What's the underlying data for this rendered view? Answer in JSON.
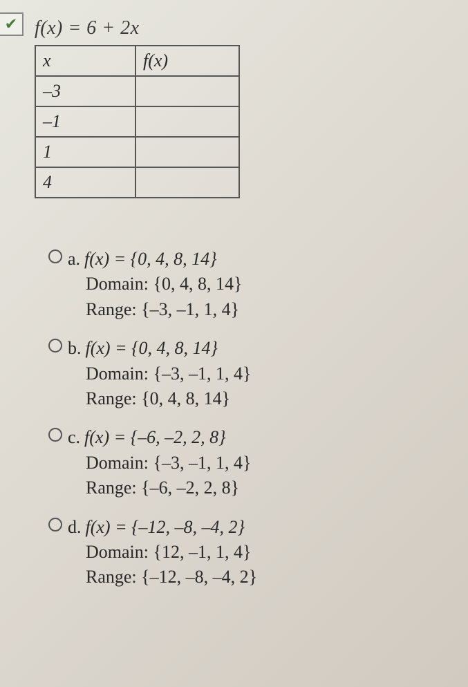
{
  "equation": "f(x) = 6 + 2x",
  "table": {
    "headers": {
      "x": "x",
      "fx": "f(x)"
    },
    "rows": [
      {
        "x": "–3",
        "fx": ""
      },
      {
        "x": "–1",
        "fx": ""
      },
      {
        "x": "1",
        "fx": ""
      },
      {
        "x": "4",
        "fx": ""
      }
    ]
  },
  "checkbox_glyph": "✔",
  "options": [
    {
      "letter": "a.",
      "fx_line": "f(x) = {0, 4, 8, 14}",
      "domain_line": "Domain: {0, 4, 8, 14}",
      "range_line": "Range: {–3, –1, 1, 4}"
    },
    {
      "letter": "b.",
      "fx_line": "f(x) = {0, 4, 8, 14}",
      "domain_line": "Domain: {–3, –1, 1, 4}",
      "range_line": "Range: {0, 4, 8, 14}"
    },
    {
      "letter": "c.",
      "fx_line": "f(x) = {–6, –2, 2, 8}",
      "domain_line": "Domain: {–3, –1, 1, 4}",
      "range_line": "Range: {–6, –2, 2, 8}"
    },
    {
      "letter": "d.",
      "fx_line": "f(x) = {–12, –8, –4, 2}",
      "domain_line": "Domain: {12, –1, 1, 4}",
      "range_line": "Range: {–12, –8, –4, 2}"
    }
  ]
}
